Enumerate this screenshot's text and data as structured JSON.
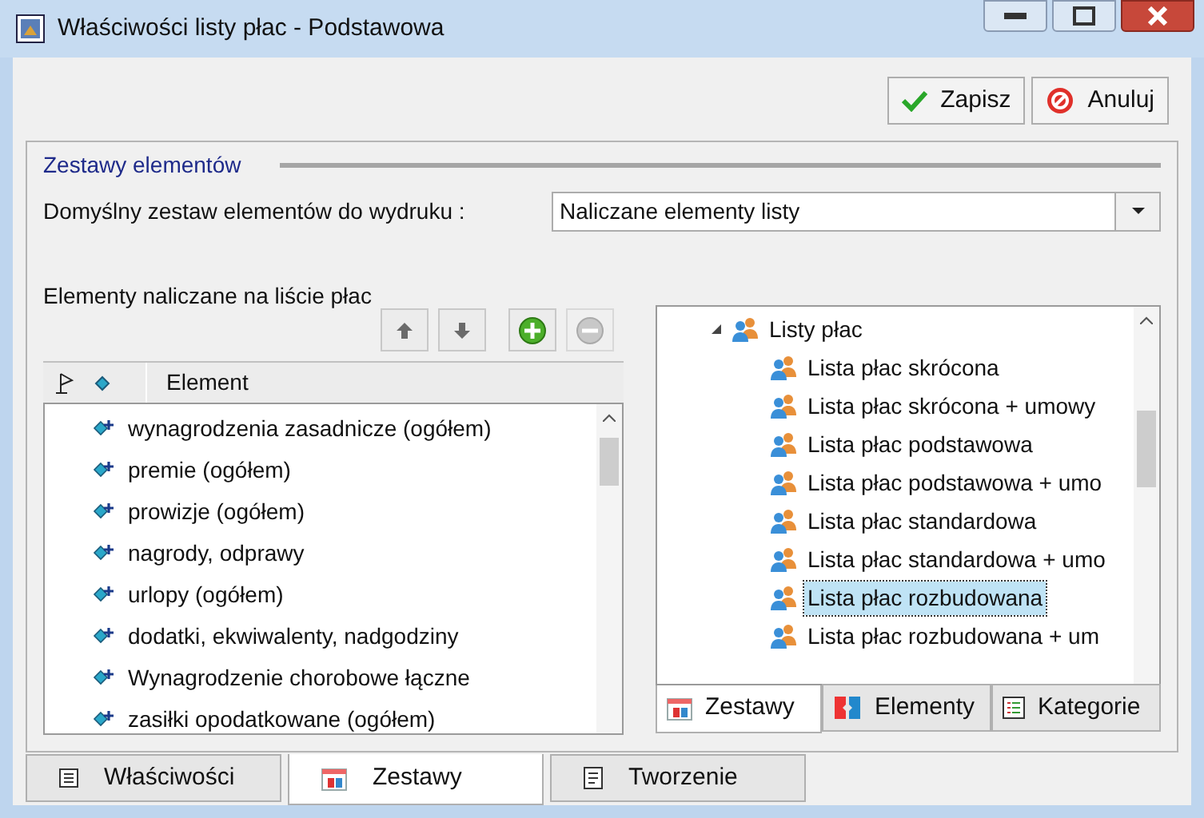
{
  "window": {
    "title": "Właściwości listy płac - Podstawowa"
  },
  "actions": [
    {
      "kind": "save",
      "label": "Zapisz"
    },
    {
      "kind": "cancel",
      "label": "Anuluj"
    }
  ],
  "section": {
    "title": "Zestawy elementów"
  },
  "default_set": {
    "label": "Domyślny zestaw elementów do wydruku :",
    "value": "Naliczane elementy listy"
  },
  "elements": {
    "title": "Elementy naliczane na liście płac",
    "toolbar": [
      {
        "kind": "up",
        "disabled": false
      },
      {
        "kind": "down",
        "disabled": false
      },
      {
        "kind": "add",
        "disabled": false
      },
      {
        "kind": "remove",
        "disabled": true
      }
    ],
    "column": "Element",
    "rows": [
      "wynagrodzenia zasadnicze (ogółem)",
      "premie (ogółem)",
      "prowizje (ogółem)",
      "nagrody, odprawy",
      "urlopy (ogółem)",
      "dodatki, ekwiwalenty, nadgodziny",
      "Wynagrodzenie chorobowe łączne",
      "zasiłki opodatkowane (ogółem)"
    ]
  },
  "tree": [
    {
      "label": "Listy płac",
      "expanded": true,
      "children": [
        {
          "label": "Lista płac skrócona",
          "selected": false
        },
        {
          "label": "Lista płac skrócona + umowy",
          "selected": false
        },
        {
          "label": "Lista płac podstawowa",
          "selected": false
        },
        {
          "label": "Lista płac podstawowa + umo",
          "selected": false
        },
        {
          "label": "Lista płac standardowa",
          "selected": false
        },
        {
          "label": "Lista płac standardowa + umo",
          "selected": false
        },
        {
          "label": "Lista płac rozbudowana",
          "selected": true
        },
        {
          "label": "Lista płac rozbudowana + um",
          "selected": false
        }
      ]
    }
  ],
  "tree_tabs": [
    {
      "kind": "sets",
      "label": "Zestawy",
      "selected": true
    },
    {
      "kind": "elements",
      "label": "Elementy",
      "selected": false
    },
    {
      "kind": "categories",
      "label": "Kategorie",
      "selected": false
    }
  ],
  "bottom_tabs": [
    {
      "kind": "properties",
      "label": "Właściwości",
      "selected": false
    },
    {
      "kind": "sets",
      "label": "Zestawy",
      "selected": true
    },
    {
      "kind": "creation",
      "label": "Tworzenie",
      "selected": false
    }
  ]
}
